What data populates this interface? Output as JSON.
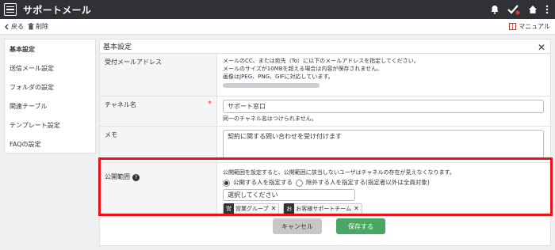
{
  "app": {
    "title": "サポートメール"
  },
  "toolbar": {
    "back_label": "戻る",
    "delete_label": "削除",
    "manual_label": "マニュアル"
  },
  "sidebar": {
    "items": [
      {
        "label": "基本設定"
      },
      {
        "label": "送信メール設定"
      },
      {
        "label": "フォルダの設定"
      },
      {
        "label": "関連テーブル"
      },
      {
        "label": "テンプレート設定"
      },
      {
        "label": "FAQの設定"
      }
    ]
  },
  "panel": {
    "title": "基本設定",
    "rows": {
      "receive_email": {
        "label": "受付メールアドレス",
        "desc1": "メールのCC、または宛先（To）に以下のメールアドレスを指定してください。",
        "desc2": "メールのサイズが10MBを超える場合は内容が保存されません。",
        "desc3": "画像はJPEG、PNG、GIFに対応しています。"
      },
      "channel": {
        "label": "チャネル名",
        "value": "サポート窓口",
        "note": "同一のチャネル名はつけられません。"
      },
      "memo": {
        "label": "メモ",
        "value": "契約に関する問い合わせを受け付けます"
      },
      "scope": {
        "label": "公開範囲",
        "help_icon": "?",
        "desc": "公開範囲を設定すると、公開範囲に該当しないユーザはチャネルの存在が見えなくなります。",
        "radio1": "公開する人を指定する",
        "radio2": "除外する人を指定する(指定者以外は全員対象)",
        "select_placeholder": "選択してください",
        "chips": [
          {
            "icon": "営",
            "label": "営業グループ"
          },
          {
            "icon": "お",
            "label": "お客様サポートチーム"
          }
        ]
      }
    }
  },
  "buttons": {
    "cancel": "キャンセル",
    "save": "保存する"
  },
  "colors": {
    "appbar": "#2f3136",
    "highlight": "#e8131a",
    "save": "#49a663",
    "required": "#e53935"
  }
}
